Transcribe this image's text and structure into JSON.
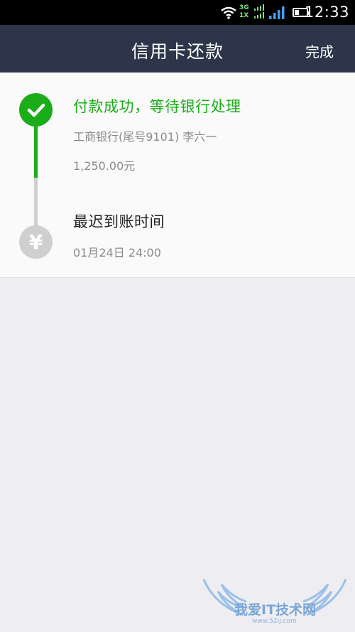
{
  "status_bar": {
    "time": "12:33",
    "network_top": "3G",
    "network_bottom": "1X",
    "icons": [
      "wifi-icon",
      "signal-icon",
      "battery-icon"
    ]
  },
  "nav": {
    "title": "信用卡还款",
    "done_label": "完成",
    "background": "#2c3549"
  },
  "timeline": {
    "success": {
      "title": "付款成功，等待银行处理",
      "bank_info": "工商银行(尾号9101) 李六一",
      "amount": "1,250.00元",
      "icon": "checkmark-icon",
      "color": "#1aad19"
    },
    "pending": {
      "title": "最迟到账时间",
      "deadline": "01月24日 24:00",
      "icon": "yuan-icon",
      "symbol": "¥",
      "color": "#cfcfcf"
    }
  },
  "watermark": {
    "text": "我爱IT技术网",
    "url": "www.52ij.com"
  }
}
